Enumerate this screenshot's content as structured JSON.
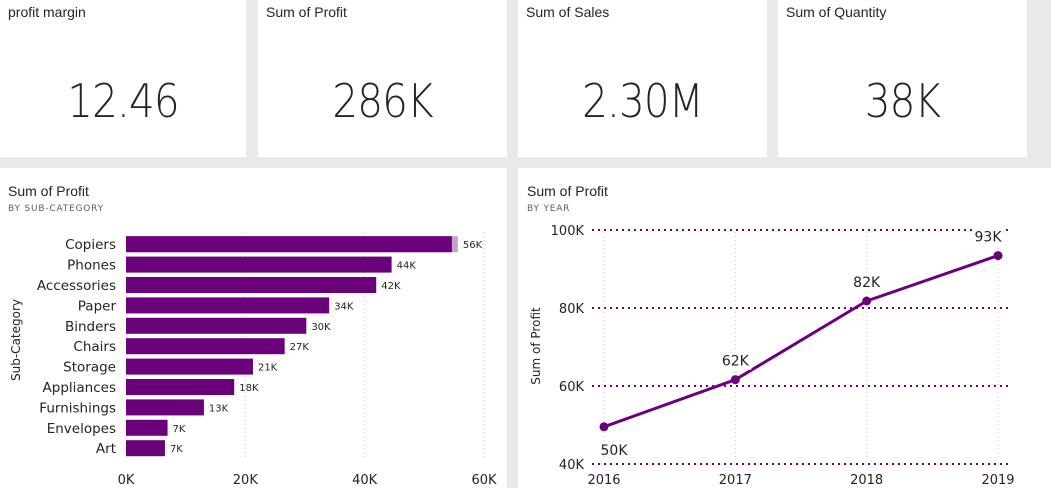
{
  "kpis": [
    {
      "title": "profit margin",
      "value": "12.46"
    },
    {
      "title": "Sum of Profit",
      "value": "286K"
    },
    {
      "title": "Sum of Sales",
      "value": "2.30M"
    },
    {
      "title": "Sum of Quantity",
      "value": "38K"
    }
  ],
  "colors": {
    "bar": "#6b007b",
    "bar_highlight": "#c7a0ce",
    "line": "#6b007b",
    "grid": "#6b007b",
    "axis_grid": "#c8c6c4"
  },
  "chart_data": [
    {
      "type": "bar",
      "orientation": "horizontal",
      "title": "Sum of Profit",
      "subtitle": "BY SUB-CATEGORY",
      "xlabel": "",
      "ylabel": "Sub-Category",
      "categories": [
        "Copiers",
        "Phones",
        "Accessories",
        "Paper",
        "Binders",
        "Chairs",
        "Storage",
        "Appliances",
        "Furnishings",
        "Envelopes",
        "Art"
      ],
      "values": [
        55618,
        44516,
        41937,
        34054,
        30222,
        26590,
        21279,
        18138,
        13059,
        6964,
        6528
      ],
      "data_labels": [
        "56K",
        "44K",
        "42K",
        "34K",
        "30K",
        "27K",
        "21K",
        "18K",
        "13K",
        "7K",
        "7K"
      ],
      "xlim": [
        0,
        60000
      ],
      "xticks": [
        0,
        20000,
        40000,
        60000
      ],
      "xtick_labels": [
        "0K",
        "20K",
        "40K",
        "60K"
      ],
      "grid": true
    },
    {
      "type": "line",
      "title": "Sum of Profit",
      "subtitle": "BY YEAR",
      "xlabel": "",
      "ylabel": "Sum of Profit",
      "x": [
        "2016",
        "2017",
        "2018",
        "2019"
      ],
      "values": [
        49544,
        61619,
        81795,
        93439
      ],
      "data_labels": [
        "50K",
        "62K",
        "82K",
        "93K"
      ],
      "ylim": [
        40000,
        100000
      ],
      "yticks": [
        40000,
        60000,
        80000,
        100000
      ],
      "ytick_labels": [
        "40K",
        "60K",
        "80K",
        "100K"
      ],
      "grid": true
    }
  ]
}
